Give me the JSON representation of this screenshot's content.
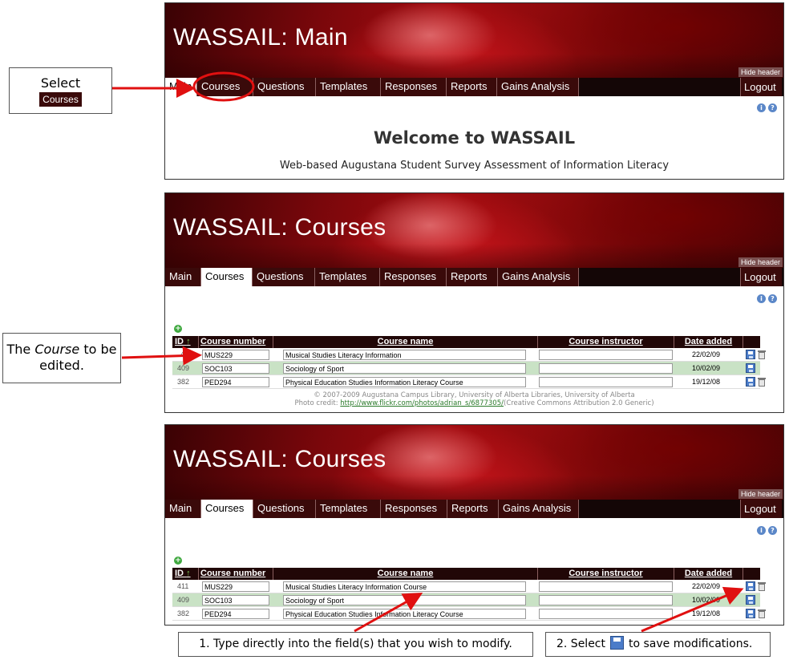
{
  "panels": [
    {
      "title": "WASSAIL: Main",
      "hide_header": "Hide header",
      "nav": [
        "Main",
        "Courses",
        "Questions",
        "Templates",
        "Responses",
        "Reports",
        "Gains Analysis"
      ],
      "logout": "Logout",
      "welcome_title": "Welcome to WASSAIL",
      "welcome_subtitle": "Web-based Augustana Student Survey Assessment of Information Literacy"
    },
    {
      "title": "WASSAIL: Courses",
      "hide_header": "Hide header",
      "nav": [
        "Main",
        "Courses",
        "Questions",
        "Templates",
        "Responses",
        "Reports",
        "Gains Analysis"
      ],
      "logout": "Logout",
      "add_icon": "+",
      "columns": [
        "ID",
        "Course number",
        "Course name",
        "Course instructor",
        "Date added"
      ],
      "rows": [
        {
          "id": "4",
          "number": "MUS229",
          "name": "Musical Studies Literacy Information",
          "instructor": "",
          "date": "22/02/09"
        },
        {
          "id": "409",
          "number": "SOC103",
          "name": "Sociology of Sport",
          "instructor": "",
          "date": "10/02/09"
        },
        {
          "id": "382",
          "number": "PED294",
          "name": "Physical Education Studies Information Literacy Course",
          "instructor": "",
          "date": "19/12/08"
        }
      ],
      "footer_line1": "© 2007-2009 Augustana Campus Library, University of Alberta Libraries, University of Alberta",
      "footer_credit_label": "Photo credit:",
      "footer_link": "http://www.flickr.com/photos/adrian_s/6877305/",
      "footer_license": "(Creative Commons Attribution 2.0 Generic)"
    },
    {
      "title": "WASSAIL: Courses",
      "hide_header": "Hide header",
      "nav": [
        "Main",
        "Courses",
        "Questions",
        "Templates",
        "Responses",
        "Reports",
        "Gains Analysis"
      ],
      "logout": "Logout",
      "add_icon": "+",
      "columns": [
        "ID",
        "Course number",
        "Course name",
        "Course instructor",
        "Date added"
      ],
      "rows": [
        {
          "id": "411",
          "number": "MUS229",
          "name": "Musical Studies Literacy Information Course",
          "instructor": "",
          "date": "22/02/09"
        },
        {
          "id": "409",
          "number": "SOC103",
          "name": "Sociology of Sport",
          "instructor": "",
          "date": "10/02/09"
        },
        {
          "id": "382",
          "number": "PED294",
          "name": "Physical Education Studies Information Literacy Course",
          "instructor": "",
          "date": "19/12/08"
        }
      ]
    }
  ],
  "callouts": {
    "select_text": "Select",
    "select_chip": "Courses",
    "edit_prefix": "The",
    "edit_italic": "Course",
    "edit_suffix": "to be edited.",
    "type_text": "1. Type directly into the field(s) that you wish to modify.",
    "save_prefix": "2. Select",
    "save_suffix": "to save modifications."
  },
  "colors": {
    "annotation": "#e01010",
    "nav_bg": "#3a0a0a",
    "row_alt": "#c9e2c5"
  }
}
